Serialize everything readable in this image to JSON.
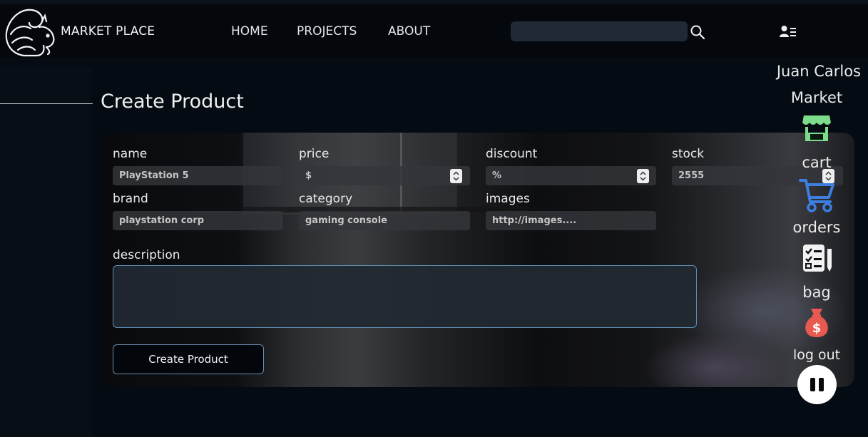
{
  "header": {
    "brand": "MARKET PLACE",
    "nav": [
      "HOME",
      "PROJECTS",
      "ABOUT"
    ],
    "search": {
      "value": "",
      "placeholder": ""
    },
    "icons": [
      "squirrel-logo",
      "search-icon",
      "user-menu-icon"
    ]
  },
  "page": {
    "title": "Create Product"
  },
  "form": {
    "name": {
      "label": "name",
      "value": "PlayStation 5"
    },
    "price": {
      "label": "price",
      "value": "$"
    },
    "discount": {
      "label": "discount",
      "value": "%"
    },
    "stock": {
      "label": "stock",
      "value": "2555"
    },
    "brand": {
      "label": "brand",
      "value": "playstation corp"
    },
    "category": {
      "label": "category",
      "value": "gaming console"
    },
    "images": {
      "label": "images",
      "value": "http://images...."
    },
    "description": {
      "label": "description",
      "value": ""
    },
    "submit_label": "Create Product"
  },
  "side_menu": {
    "user_name": "Juan Carlos",
    "items": [
      {
        "label": "Market",
        "icon": "market-stall-icon"
      },
      {
        "label": "cart",
        "icon": "cart-icon"
      },
      {
        "label": "orders",
        "icon": "orders-checklist-icon"
      },
      {
        "label": "bag",
        "icon": "money-bag-icon"
      },
      {
        "label": "log out",
        "icon": "pause-icon"
      }
    ]
  },
  "colors": {
    "background": "#050b12",
    "header": "#04080d",
    "market_icon": "#7ddc8c",
    "cart_icon": "#3c7fe0",
    "bag_icon": "#e85a4f",
    "button_border": "#6c8db0"
  }
}
